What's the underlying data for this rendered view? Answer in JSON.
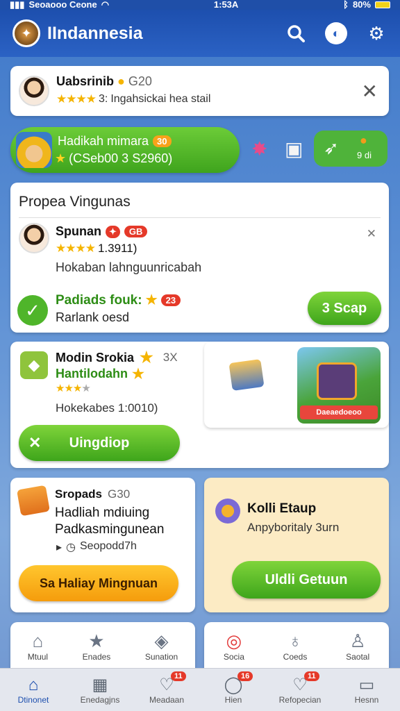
{
  "status": {
    "carrier": "Seoaooo Ceone",
    "time": "1:53A",
    "battery": "80%"
  },
  "header": {
    "title": "IIndannesia"
  },
  "notification": {
    "name": "Uabsrinib",
    "code": "G20",
    "rating_text": "3:",
    "message": "Ingahsickai hea stail"
  },
  "rewards_banner": {
    "title": "Hadikah mimara",
    "badge": "30",
    "subtitle": "(CSeb00 3 S2960)",
    "right_label": "9 di"
  },
  "promo": {
    "title": "Propea Vingunas",
    "user_name": "Spunan",
    "badge": "GB",
    "rating": "1.3911)",
    "desc": "Hokaban lahnguunricabah",
    "reward_title": "Padiads fouk:",
    "reward_badge": "23",
    "reward_sub": "Rarlank oesd",
    "btn_label": "3 Scap"
  },
  "mission": {
    "title": "Modin Srokia",
    "count": "3X",
    "subtitle": "Hantilodahn",
    "desc": "Hokekabes 1:0010)",
    "btn_label": "Uingdiop"
  },
  "game_banner": {
    "label": "Daeaedoeoo"
  },
  "shop_card": {
    "name": "Sropads",
    "code": "G30",
    "line1": "Hadliah mdiuing",
    "line2": "Padkasmingunean",
    "meta": "Seopodd7h",
    "btn_label": "Sa Haliay Mingnuan"
  },
  "event_card": {
    "title": "Kolli Etaup",
    "subtitle": "Anpyboritaly 3urn",
    "btn_label": "Uldli Getuun"
  },
  "shortcuts_left": [
    "Mtuul",
    "Enades",
    "Sunation"
  ],
  "shortcuts_right": [
    "Socia",
    "Coeds",
    "Saotal"
  ],
  "tabs": [
    {
      "label": "Dtinonet",
      "badge": ""
    },
    {
      "label": "Enedagjns",
      "badge": ""
    },
    {
      "label": "Meadaan",
      "badge": "11"
    },
    {
      "label": "Hien",
      "badge": "16"
    },
    {
      "label": "Refopecian",
      "badge": "11"
    },
    {
      "label": "Hesnn",
      "badge": ""
    }
  ],
  "colors": {
    "primary": "#1d4fae",
    "green": "#3ea51b",
    "orange": "#f59c0c",
    "badge": "#e53929"
  }
}
